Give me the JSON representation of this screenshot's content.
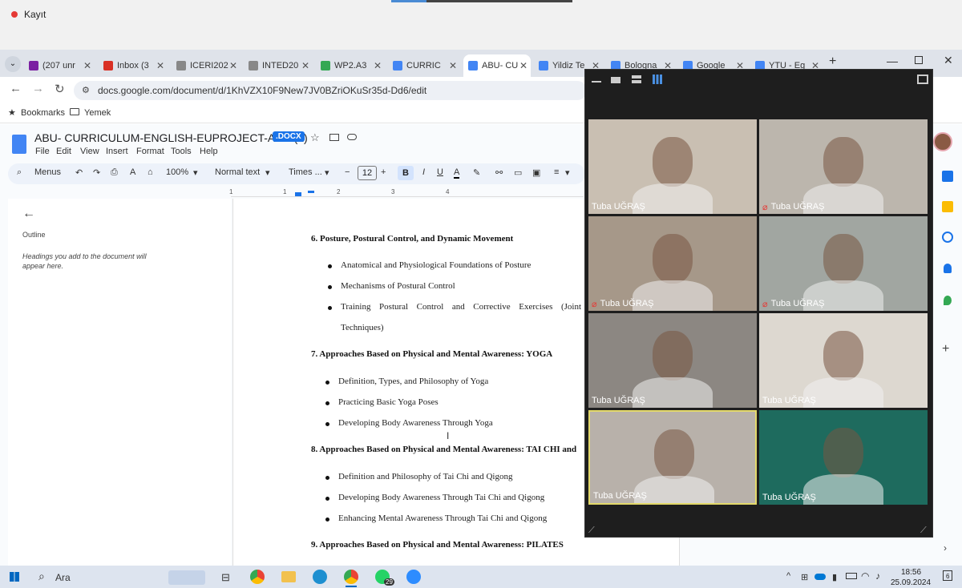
{
  "recorder": {
    "label": "Kayıt"
  },
  "browser": {
    "tabs": [
      {
        "label": "(207 unr",
        "color": "#7b1fa2"
      },
      {
        "label": "Inbox (3",
        "color": "#d93025"
      },
      {
        "label": "ICERI202",
        "color": "#888888"
      },
      {
        "label": "INTED20",
        "color": "#888888"
      },
      {
        "label": "WP2.A3",
        "color": "#34a853"
      },
      {
        "label": "CURRIC",
        "color": "#4285f4"
      },
      {
        "label": "ABU- CU",
        "color": "#4285f4"
      },
      {
        "label": "Yildiz Te",
        "color": "#4285f4"
      },
      {
        "label": "Bologna",
        "color": "#4285f4"
      },
      {
        "label": "Google",
        "color": "#4285f4"
      },
      {
        "label": "YTU - Eg",
        "color": "#4285f4"
      }
    ],
    "url": "docs.google.com/document/d/1KhVZX10F9New7JV0BZriOKuSr35d-Dd6/edit",
    "bookmarks": [
      {
        "label": "Bookmarks"
      },
      {
        "label": "Yemek"
      }
    ]
  },
  "docs": {
    "title": "ABU- CURRICULUM-ENGLISH-EUPROJECT-ABU (1)",
    "badge": ".DOCX",
    "menus": [
      "File",
      "Edit",
      "View",
      "Insert",
      "Format",
      "Tools",
      "Help"
    ],
    "toolbar": {
      "search": "Menus",
      "zoom": "100%",
      "style": "Normal text",
      "font": "Times ...",
      "size": "12"
    },
    "ruler": [
      "1",
      "1",
      "2",
      "3",
      "4"
    ],
    "outline": {
      "title": "Outline",
      "hint": "Headings you add to the document will appear here."
    },
    "content": {
      "h6": "6. Posture, Postural Control, and Dynamic Movement",
      "h6_items": [
        "Anatomical and Physiological Foundations of Posture",
        "Mechanisms of Postural Control",
        "Training Postural Control and Corrective Exercises (Joint",
        "Techniques)"
      ],
      "h7": "7. Approaches Based on Physical and Mental Awareness: YOGA",
      "h7_items": [
        "Definition, Types, and Philosophy of Yoga",
        "Practicing Basic Yoga Poses",
        "Developing Body Awareness Through Yoga"
      ],
      "h8": "8. Approaches Based on Physical and Mental Awareness: TAI CHI and",
      "h8_items": [
        "Definition and Philosophy of Tai Chi and Qigong",
        "Developing Body Awareness Through Tai Chi and Qigong",
        "Enhancing Mental Awareness Through Tai Chi and Qigong"
      ],
      "h9": "9. Approaches Based on Physical and Mental Awareness: PILATES"
    }
  },
  "zoom": {
    "participants": [
      {
        "name": "Tuba UĞRAŞ",
        "muted": false,
        "bg": "#c9bfb2"
      },
      {
        "name": "Tuba UĞRAŞ",
        "muted": true,
        "bg": "#bcb6ad"
      },
      {
        "name": "Tuba UĞRAŞ",
        "muted": true,
        "bg": "#a69889"
      },
      {
        "name": "Tuba UĞRAŞ",
        "muted": true,
        "bg": "#a1a6a1"
      },
      {
        "name": "Tuba UĞRAŞ",
        "muted": false,
        "bg": "#8c8782"
      },
      {
        "name": "Tuba UĞRAŞ",
        "muted": false,
        "bg": "#ddd8d0"
      },
      {
        "name": "Tuba UĞRAŞ",
        "muted": false,
        "bg": "#b8b1aa"
      },
      {
        "name": "Tuba UĞRAŞ",
        "muted": false,
        "bg": "#1e6b5e"
      }
    ]
  },
  "taskbar": {
    "search": "Ara",
    "badge": "29",
    "time": "18:56",
    "date": "25.09.2024",
    "notif": "6"
  }
}
